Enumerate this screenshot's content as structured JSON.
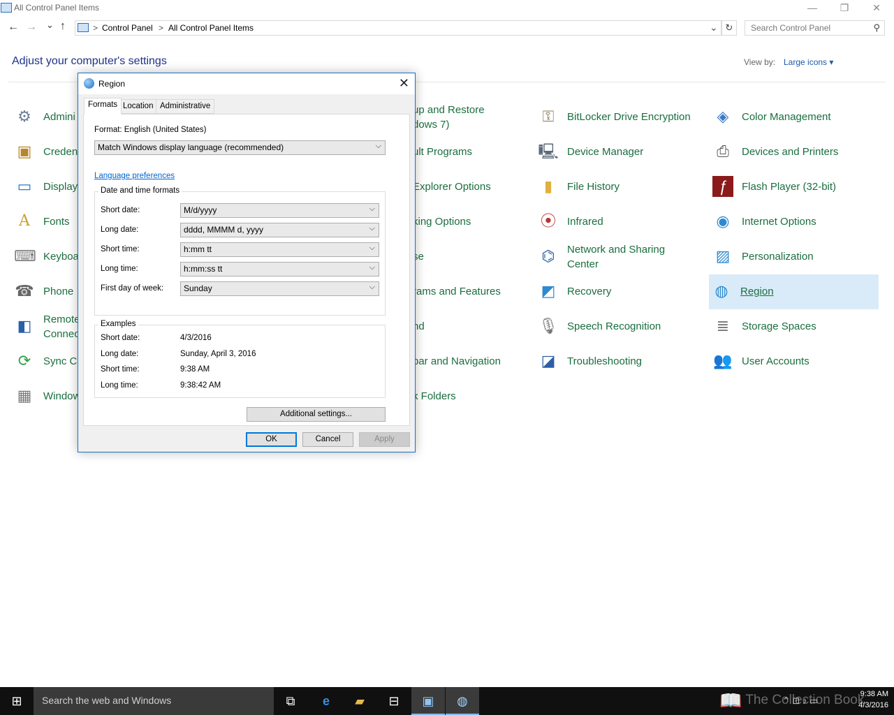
{
  "window": {
    "title": "All Control Panel Items",
    "minimize": "—",
    "restore": "❐",
    "close": "✕"
  },
  "nav": {
    "back": "←",
    "forward": "→",
    "recent": "⌄",
    "up": "↑",
    "breadcrumb_sep": ">",
    "breadcrumb": [
      "Control Panel",
      "All Control Panel Items"
    ],
    "dropdown": "⌄",
    "refresh": "↻",
    "search_placeholder": "Search Control Panel",
    "search_icon": "⚲"
  },
  "heading": "Adjust your computer's settings",
  "view_by": {
    "label": "View by:",
    "value": "Large icons ▾"
  },
  "items": {
    "col1": [
      "Admini",
      "Creden",
      "Display",
      "Fonts",
      "Keyboa",
      "Phone",
      "Remote",
      "Sync Ce",
      "Window"
    ],
    "col1_remote_line2": "Connec",
    "col3": [
      "up and Restore",
      "ult Programs",
      "Explorer Options",
      "king Options",
      "se",
      "rams and Features",
      "nd",
      "bar and Navigation",
      "k Folders"
    ],
    "col3_backup_line2": "dows 7)",
    "col4": [
      "BitLocker Drive Encryption",
      "Device Manager",
      "File History",
      "Infrared",
      "Network and Sharing",
      "Recovery",
      "Speech Recognition",
      "Troubleshooting"
    ],
    "col4_network_line2": "Center",
    "col5": [
      "Color Management",
      "Devices and Printers",
      "Flash Player (32-bit)",
      "Internet Options",
      "Personalization",
      "Region",
      "Storage Spaces",
      "User Accounts"
    ]
  },
  "dialog": {
    "title": "Region",
    "close": "✕",
    "tabs": [
      "Formats",
      "Location",
      "Administrative"
    ],
    "format_label": "Format: English (United States)",
    "format_value": "Match Windows display language (recommended)",
    "language_link": "Language preferences",
    "datetime_group": "Date and time formats",
    "fields": [
      {
        "label": "Short date:",
        "value": "M/d/yyyy"
      },
      {
        "label": "Long date:",
        "value": "dddd, MMMM d, yyyy"
      },
      {
        "label": "Short time:",
        "value": "h:mm tt"
      },
      {
        "label": "Long time:",
        "value": "h:mm:ss tt"
      },
      {
        "label": "First day of week:",
        "value": "Sunday"
      }
    ],
    "examples_group": "Examples",
    "examples": [
      {
        "label": "Short date:",
        "value": "4/3/2016"
      },
      {
        "label": "Long date:",
        "value": "Sunday, April 3, 2016"
      },
      {
        "label": "Short time:",
        "value": "9:38 AM"
      },
      {
        "label": "Long time:",
        "value": "9:38:42 AM"
      }
    ],
    "additional": "Additional settings...",
    "ok": "OK",
    "cancel": "Cancel",
    "apply": "Apply",
    "chevron": "⌵"
  },
  "taskbar": {
    "start": "⊞",
    "search": "Search the web and Windows",
    "watermark": "The Collection Book",
    "time": "9:38 AM",
    "date": "4/3/2016",
    "tray_icons": "⌃ ⊡ ♪ ▭"
  },
  "colors": {
    "accent": "#0078d7",
    "link_green": "#1a6e3f",
    "selection": "#d9ebf9"
  }
}
